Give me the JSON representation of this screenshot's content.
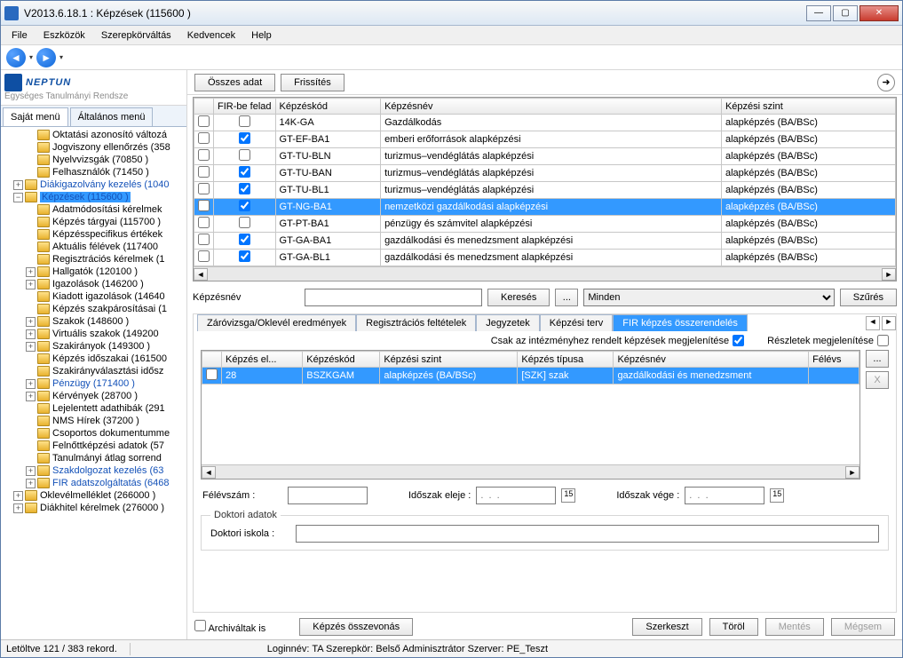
{
  "window": {
    "title": "V2013.6.18.1 : Képzések (115600  )"
  },
  "menu": [
    "File",
    "Eszközök",
    "Szerepkörváltás",
    "Kedvencek",
    "Help"
  ],
  "logo": {
    "name": "NEPTUN",
    "subtitle": "Egységes Tanulmányi Rendsze"
  },
  "sidebar_tabs": {
    "active": "Saját menü",
    "inactive": "Általános menü"
  },
  "tree": [
    {
      "ind": 2,
      "exp": "none",
      "label": "Oktatási azonosító változá"
    },
    {
      "ind": 2,
      "exp": "none",
      "label": "Jogviszony ellenőrzés (358"
    },
    {
      "ind": 2,
      "exp": "none",
      "label": "Nyelvvizsgák (70850  )"
    },
    {
      "ind": 2,
      "exp": "none",
      "label": "Felhasználók (71450  )"
    },
    {
      "ind": 1,
      "exp": "+",
      "label": "Diákigazolvány kezelés (1040",
      "link": true
    },
    {
      "ind": 1,
      "exp": "-",
      "label": "Képzések (115600  )",
      "selected": true,
      "link": true
    },
    {
      "ind": 2,
      "exp": "none",
      "label": "Adatmódosítási kérelmek"
    },
    {
      "ind": 2,
      "exp": "none",
      "label": "Képzés tárgyai (115700  )"
    },
    {
      "ind": 2,
      "exp": "none",
      "label": "Képzésspecifikus értékek"
    },
    {
      "ind": 2,
      "exp": "none",
      "label": "Aktuális félévek (117400"
    },
    {
      "ind": 2,
      "exp": "none",
      "label": "Regisztrációs kérelmek (1"
    },
    {
      "ind": 2,
      "exp": "+",
      "label": "Hallgatók (120100  )"
    },
    {
      "ind": 2,
      "exp": "+",
      "label": "Igazolások (146200  )"
    },
    {
      "ind": 2,
      "exp": "none",
      "label": "Kiadott igazolások (14640"
    },
    {
      "ind": 2,
      "exp": "none",
      "label": "Képzés szakpárosításai (1"
    },
    {
      "ind": 2,
      "exp": "+",
      "label": "Szakok (148600  )"
    },
    {
      "ind": 2,
      "exp": "+",
      "label": "Virtuális szakok (149200"
    },
    {
      "ind": 2,
      "exp": "+",
      "label": "Szakirányok (149300  )"
    },
    {
      "ind": 2,
      "exp": "none",
      "label": "Képzés időszakai (161500"
    },
    {
      "ind": 2,
      "exp": "none",
      "label": "Szakirányválasztási idősz"
    },
    {
      "ind": 2,
      "exp": "+",
      "label": "Pénzügy (171400  )",
      "link": true
    },
    {
      "ind": 2,
      "exp": "+",
      "label": "Kérvények (28700  )"
    },
    {
      "ind": 2,
      "exp": "none",
      "label": "Lejelentett adathibák (291"
    },
    {
      "ind": 2,
      "exp": "none",
      "label": "NMS Hírek (37200  )"
    },
    {
      "ind": 2,
      "exp": "none",
      "label": "Csoportos dokumentumme"
    },
    {
      "ind": 2,
      "exp": "none",
      "label": "Felnőttképzési adatok (57"
    },
    {
      "ind": 2,
      "exp": "none",
      "label": "Tanulmányi átlag sorrend"
    },
    {
      "ind": 2,
      "exp": "+",
      "label": "Szakdolgozat kezelés (63",
      "link": true
    },
    {
      "ind": 2,
      "exp": "+",
      "label": "FIR adatszolgáltatás (6468",
      "link": true
    },
    {
      "ind": 1,
      "exp": "+",
      "label": "Oklevélmelléklet (266000  )"
    },
    {
      "ind": 1,
      "exp": "+",
      "label": "Diákhitel kérelmek (276000  )"
    }
  ],
  "top_buttons": {
    "all_data": "Összes adat",
    "refresh": "Frissítés"
  },
  "main_grid": {
    "headers": [
      "",
      "FIR-be felad",
      "Képzéskód",
      "Képzésnév",
      "Képzési szint"
    ],
    "rows": [
      {
        "fir": false,
        "kod": "14K-GA",
        "nev": "Gazdálkodás",
        "szint": "alapképzés (BA/BSc)"
      },
      {
        "fir": true,
        "kod": "GT-EF-BA1",
        "nev": "emberi erőforrások alapképzési",
        "szint": "alapképzés (BA/BSc)"
      },
      {
        "fir": false,
        "kod": "GT-TU-BLN",
        "nev": "turizmus–vendéglátás alapképzési",
        "szint": "alapképzés (BA/BSc)"
      },
      {
        "fir": true,
        "kod": "GT-TU-BAN",
        "nev": "turizmus–vendéglátás alapképzési",
        "szint": "alapképzés (BA/BSc)"
      },
      {
        "fir": true,
        "kod": "GT-TU-BL1",
        "nev": "turizmus–vendéglátás alapképzési",
        "szint": "alapképzés (BA/BSc)"
      },
      {
        "fir": true,
        "kod": "GT-NG-BA1",
        "nev": "nemzetközi gazdálkodási alapképzési",
        "szint": "alapképzés (BA/BSc)",
        "selected": true
      },
      {
        "fir": false,
        "kod": "GT-PT-BA1",
        "nev": "pénzügy és számvitel alapképzési",
        "szint": "alapképzés (BA/BSc)"
      },
      {
        "fir": true,
        "kod": "GT-GA-BA1",
        "nev": "gazdálkodási és menedzsment alapképzési",
        "szint": "alapképzés (BA/BSc)"
      },
      {
        "fir": true,
        "kod": "GT-GA-BL1",
        "nev": "gazdálkodási és menedzsment alapképzési",
        "szint": "alapképzés (BA/BSc)"
      }
    ]
  },
  "search": {
    "label": "Képzésnév",
    "search_btn": "Keresés",
    "browse_btn": "...",
    "dropdown_value": "Minden",
    "filter_btn": "Szűrés"
  },
  "tabs": {
    "items": [
      "Záróvizsga/Oklevél eredmények",
      "Regisztrációs feltételek",
      "Jegyzetek",
      "Képzési terv",
      "FIR képzés összerendelés"
    ],
    "active_index": 4
  },
  "assign": {
    "chk1_label": "Csak az intézményhez rendelt képzések megjelenítése",
    "chk1_checked": true,
    "chk2_label": "Részletek megjelenítése",
    "chk2_checked": false,
    "grid_headers": [
      "",
      "Képzés el...",
      "Képzéskód",
      "Képzési szint",
      "Képzés típusa",
      "Képzésnév",
      "Félévs"
    ],
    "grid_row": {
      "el": "28",
      "kod": "BSZKGAM",
      "szint": "alapképzés (BA/BSc)",
      "tipus": "[SZK] szak",
      "nev": "gazdálkodási és menedzsment",
      "felev": ""
    },
    "side_btns": {
      "dots": "...",
      "x": "X"
    }
  },
  "form": {
    "felevszam_label": "Félévszám :",
    "idoszak_eleje_label": "Időszak eleje :",
    "idoszak_vege_label": "Időszak vége :",
    "date_placeholder": ".  .  .",
    "doktori_legend": "Doktori adatok",
    "doktori_iskola_label": "Doktori iskola :"
  },
  "bottom": {
    "archive_label": "Archiváltak is",
    "merge_btn": "Képzés összevonás",
    "edit_btn": "Szerkeszt",
    "delete_btn": "Töröl",
    "save_btn": "Mentés",
    "cancel_btn": "Mégsem"
  },
  "status": {
    "records": "Letöltve 121 / 383 rekord.",
    "login": "Loginnév: TA   Szerepkör: Belső Adminisztrátor   Szerver: PE_Teszt"
  }
}
